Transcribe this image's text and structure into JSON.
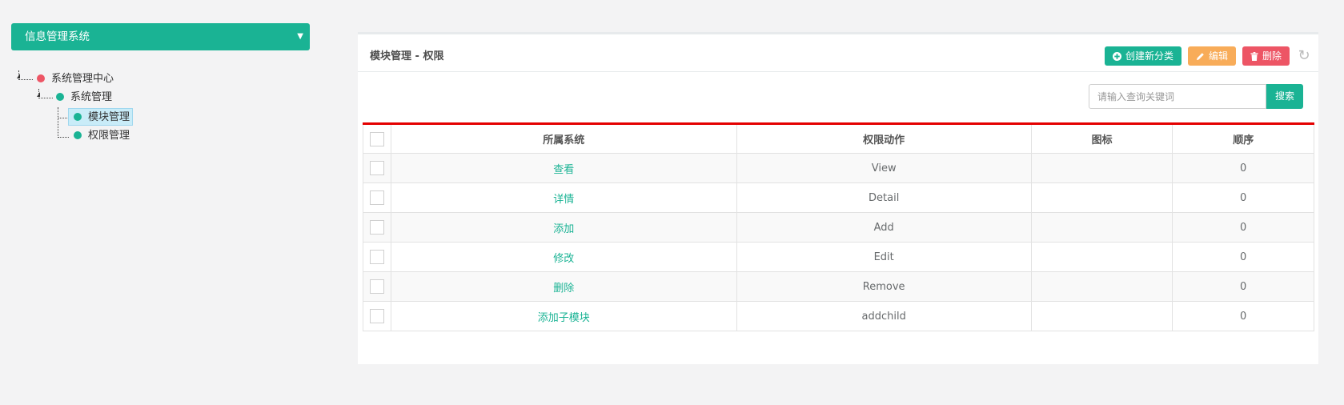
{
  "system_select": {
    "label": "信息管理系统",
    "caret": "▼"
  },
  "tree": {
    "root": {
      "label": "系统管理中心",
      "color": "#ed5565"
    },
    "child": {
      "label": "系统管理",
      "color": "#1ab394"
    },
    "leaves": [
      {
        "label": "模块管理",
        "selected": true
      },
      {
        "label": "权限管理",
        "selected": false
      }
    ]
  },
  "panel": {
    "title": "模块管理 - 权限",
    "toolbar": {
      "create_label": "创建新分类",
      "edit_label": "编辑",
      "delete_label": "删除"
    },
    "search": {
      "placeholder": "请输入查询关键词",
      "button_label": "搜索"
    },
    "table": {
      "headers": [
        "所属系统",
        "权限动作",
        "图标",
        "顺序"
      ],
      "rows": [
        {
          "system": "查看",
          "action": "View",
          "icon": "",
          "order": "0"
        },
        {
          "system": "详情",
          "action": "Detail",
          "icon": "",
          "order": "0"
        },
        {
          "system": "添加",
          "action": "Add",
          "icon": "",
          "order": "0"
        },
        {
          "system": "修改",
          "action": "Edit",
          "icon": "",
          "order": "0"
        },
        {
          "system": "删除",
          "action": "Remove",
          "icon": "",
          "order": "0"
        },
        {
          "system": "添加子模块",
          "action": "addchild",
          "icon": "",
          "order": "0"
        }
      ]
    }
  },
  "colors": {
    "primary": "#1ab394",
    "warning": "#f8ac59",
    "danger": "#ed5565",
    "table_top_border": "#e40000"
  }
}
